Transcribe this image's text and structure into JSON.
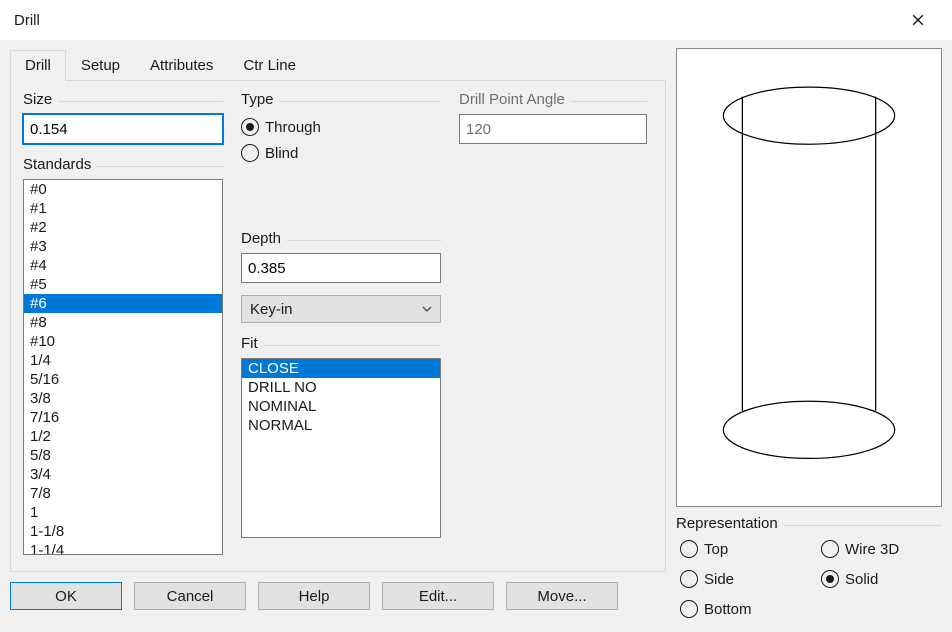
{
  "window": {
    "title": "Drill"
  },
  "tabs": [
    "Drill",
    "Setup",
    "Attributes",
    "Ctr Line"
  ],
  "active_tab": 0,
  "size": {
    "label": "Size",
    "value": "0.154"
  },
  "standards": {
    "label": "Standards",
    "items": [
      "#0",
      "#1",
      "#2",
      "#3",
      "#4",
      "#5",
      "#6",
      "#8",
      "#10",
      "1/4",
      "5/16",
      "3/8",
      "7/16",
      "1/2",
      "5/8",
      "3/4",
      "7/8",
      "1",
      "1-1/8",
      "1-1/4"
    ],
    "selected_index": 6
  },
  "type": {
    "label": "Type",
    "options": [
      "Through",
      "Blind"
    ],
    "selected_index": 0
  },
  "depth": {
    "label": "Depth",
    "value": "0.385"
  },
  "depth_mode": {
    "value": "Key-in"
  },
  "fit": {
    "label": "Fit",
    "items": [
      "CLOSE",
      "DRILL NO",
      "NOMINAL",
      "NORMAL"
    ],
    "selected_index": 0
  },
  "angle": {
    "label": "Drill Point Angle",
    "value": "120"
  },
  "representation": {
    "label": "Representation",
    "options": [
      "Top",
      "Wire 3D",
      "Side",
      "Solid",
      "Bottom"
    ],
    "selected_index": 3
  },
  "buttons": {
    "ok": "OK",
    "cancel": "Cancel",
    "help": "Help",
    "edit": "Edit...",
    "move": "Move..."
  }
}
